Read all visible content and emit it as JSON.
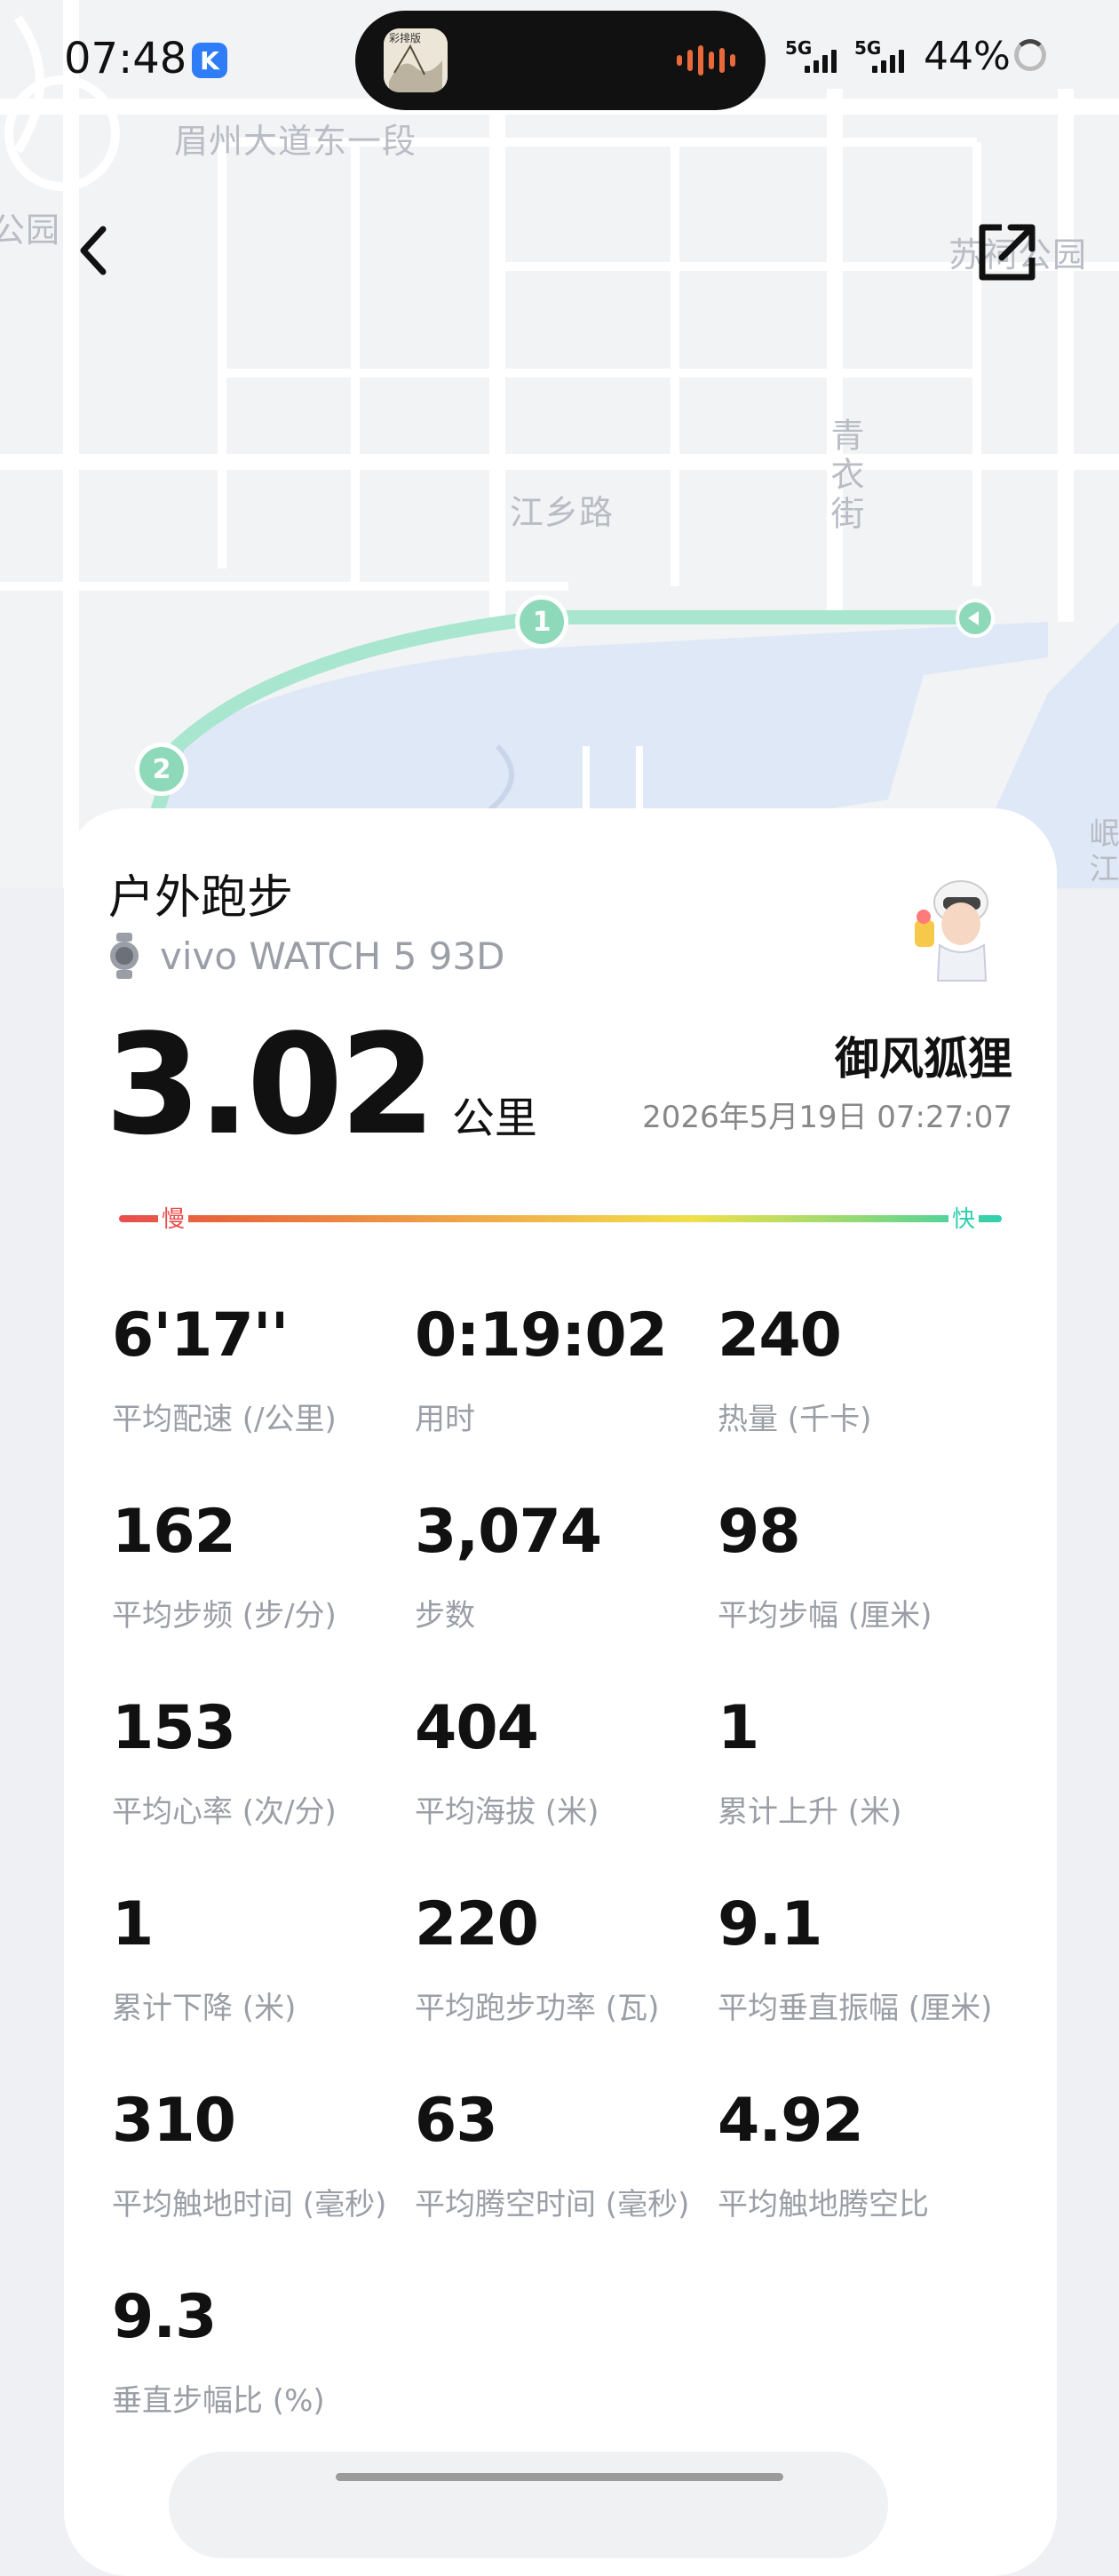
{
  "status_bar": {
    "time": "07:48",
    "k_badge": "K",
    "signal1": "5G",
    "signal2": "5G",
    "battery": "44%",
    "island_art_text": "彩排版"
  },
  "map": {
    "labels": {
      "road_top": "眉州大道东一段",
      "park_left": "公园",
      "park_right": "苏祠公园",
      "road_mid": "江乡路",
      "street_v": "青衣街",
      "river_v": "岷江"
    },
    "markers": [
      "1",
      "2"
    ],
    "route_color": "#a8e6cf"
  },
  "activity": {
    "title": "户外跑步",
    "device": "vivo WATCH 5 93D",
    "distance": "3.02",
    "distance_unit": "公里",
    "username": "御风狐狸",
    "datetime": "2026年5月19日 07:27:07"
  },
  "pace_bar": {
    "slow": "慢",
    "fast": "快"
  },
  "stats": [
    {
      "value": "6'17''",
      "label": "平均配速 (/公里)"
    },
    {
      "value": "0:19:02",
      "label": "用时"
    },
    {
      "value": "240",
      "label": "热量 (千卡)"
    },
    {
      "value": "162",
      "label": "平均步频 (步/分)"
    },
    {
      "value": "3,074",
      "label": "步数"
    },
    {
      "value": "98",
      "label": "平均步幅 (厘米)"
    },
    {
      "value": "153",
      "label": "平均心率 (次/分)"
    },
    {
      "value": "404",
      "label": "平均海拔 (米)"
    },
    {
      "value": "1",
      "label": "累计上升 (米)"
    },
    {
      "value": "1",
      "label": "累计下降 (米)"
    },
    {
      "value": "220",
      "label": "平均跑步功率 (瓦)"
    },
    {
      "value": "9.1",
      "label": "平均垂直振幅 (厘米)"
    },
    {
      "value": "310",
      "label": "平均触地时间 (毫秒)"
    },
    {
      "value": "63",
      "label": "平均腾空时间 (毫秒)"
    },
    {
      "value": "4.92",
      "label": "平均触地腾空比"
    },
    {
      "value": "9.3",
      "label": "垂直步幅比 (%)"
    }
  ],
  "colors": {
    "slow": "#e84d4d",
    "fast": "#2ecfb0",
    "water": "#dfe8f6"
  }
}
